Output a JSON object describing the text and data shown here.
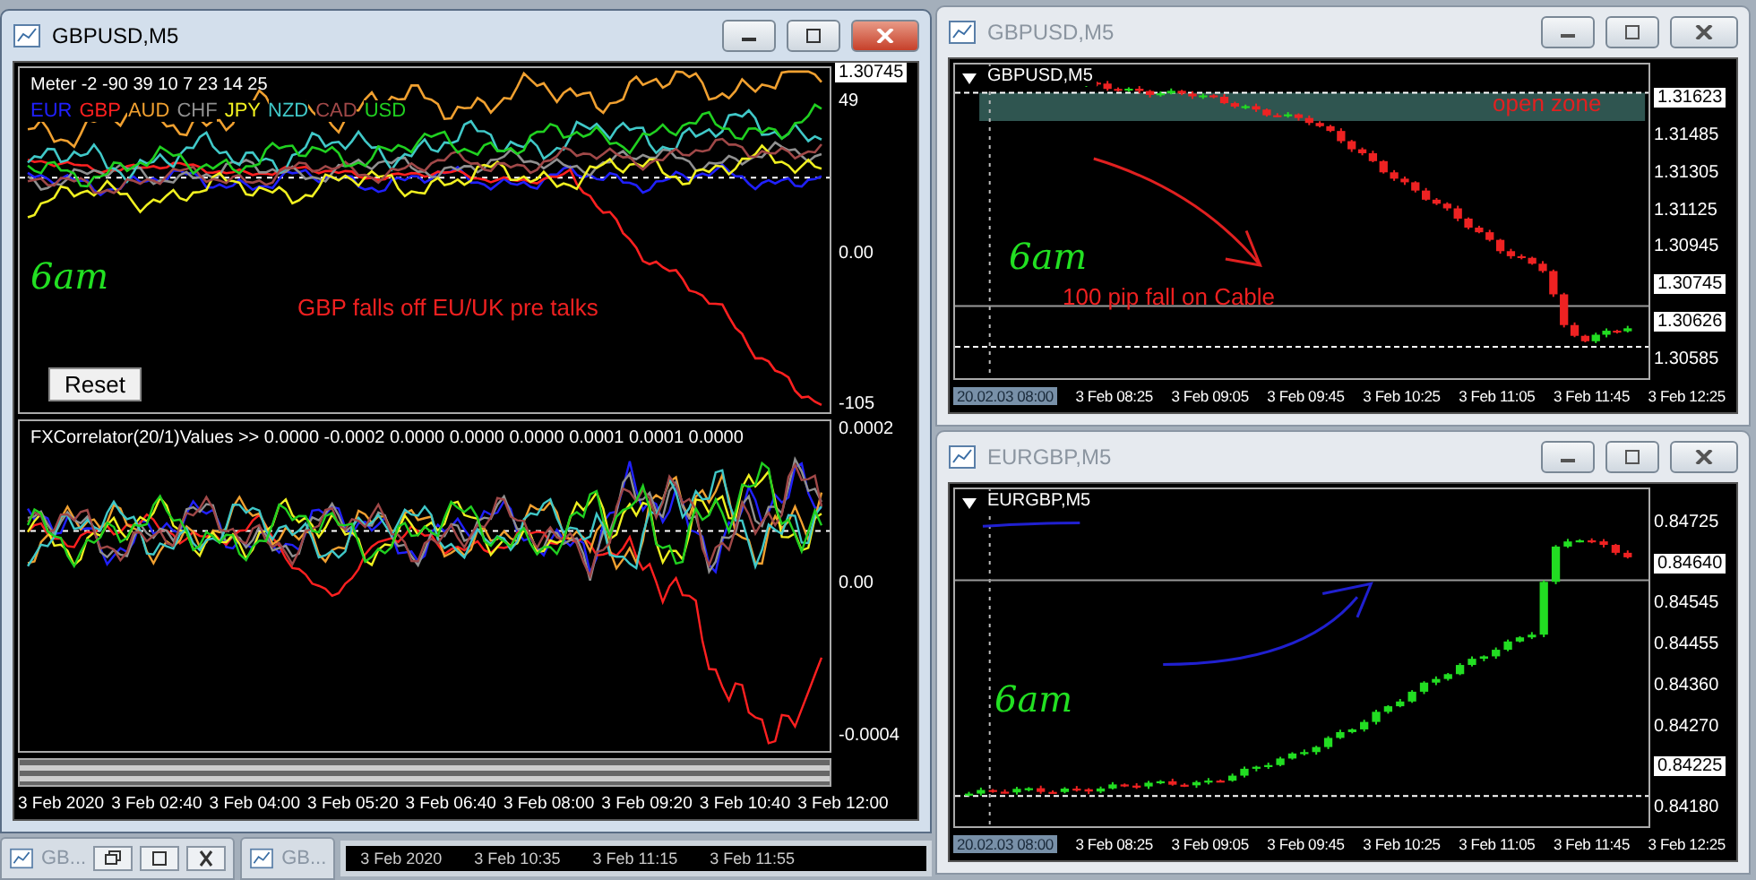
{
  "meter_window": {
    "title": "GBPUSD,M5",
    "active": true,
    "meter_pane": {
      "header": "Meter -2 -90 39 10 7 23 14 25",
      "legend": [
        {
          "label": "EUR",
          "color": "#2020ff"
        },
        {
          "label": "GBP",
          "color": "#ff2020"
        },
        {
          "label": "AUD",
          "color": "#f0a030"
        },
        {
          "label": "CHF",
          "color": "#909090"
        },
        {
          "label": "JPY",
          "color": "#f0f020"
        },
        {
          "label": "NZD",
          "color": "#40c8c8"
        },
        {
          "label": "CAD",
          "color": "#a04848"
        },
        {
          "label": "USD",
          "color": "#20d020"
        }
      ],
      "price_tag": "1.30745",
      "scale": [
        "49",
        "0.00",
        "-105"
      ],
      "note": "GBP falls off EU/UK pre talks",
      "handwriting": "6am",
      "button": "Reset"
    },
    "correlator_pane": {
      "header": "FXCorrelator(20/1)Values >> 0.0000 -0.0002 0.0000 0.0000 0.0000 0.0001 0.0001 0.0000",
      "scale": [
        "0.0002",
        "0.00",
        "-0.0004"
      ]
    },
    "time_axis": [
      "3 Feb 2020",
      "3 Feb 02:40",
      "3 Feb 04:00",
      "3 Feb 05:20",
      "3 Feb 06:40",
      "3 Feb 08:00",
      "3 Feb 09:20",
      "3 Feb 10:40",
      "3 Feb 12:00"
    ]
  },
  "minimized": [
    {
      "label": "GB..."
    },
    {
      "label": "GB..."
    }
  ],
  "background_window": {
    "time_axis": [
      "3 Feb 2020",
      "3 Feb 10:35",
      "3 Feb 11:15",
      "3 Feb 11:55"
    ]
  },
  "price_windows": [
    {
      "kind": "falling",
      "title": "GBPUSD,M5",
      "active": false,
      "symbol": "GBPUSD,M5",
      "zone": "open zone",
      "note": "100 pip fall on Cable",
      "handwriting": "6am",
      "scale": [
        {
          "text": "1.31623",
          "highlighted": true
        },
        {
          "text": "1.31485",
          "highlighted": false
        },
        {
          "text": "1.31305",
          "highlighted": false
        },
        {
          "text": "1.31125",
          "highlighted": false
        },
        {
          "text": "1.30945",
          "highlighted": false
        },
        {
          "text": "1.30745",
          "highlighted": true
        },
        {
          "text": "1.30626",
          "highlighted": true
        },
        {
          "text": "1.30585",
          "highlighted": false
        }
      ],
      "time_axis": [
        {
          "text": "20.02.03 08:00",
          "highlighted": true
        },
        {
          "text": "3 Feb 08:25",
          "highlighted": false
        },
        {
          "text": "3 Feb 09:05",
          "highlighted": false
        },
        {
          "text": "3 Feb 09:45",
          "highlighted": false
        },
        {
          "text": "3 Feb 10:25",
          "highlighted": false
        },
        {
          "text": "3 Feb 11:05",
          "highlighted": false
        },
        {
          "text": "3 Feb 11:45",
          "highlighted": false
        },
        {
          "text": "3 Feb 12:25",
          "highlighted": false
        }
      ]
    },
    {
      "kind": "rising",
      "title": "EURGBP,M5",
      "active": false,
      "symbol": "EURGBP,M5",
      "handwriting": "6am",
      "scale": [
        {
          "text": "0.84725",
          "highlighted": false
        },
        {
          "text": "0.84640",
          "highlighted": true
        },
        {
          "text": "0.84545",
          "highlighted": false
        },
        {
          "text": "0.84455",
          "highlighted": false
        },
        {
          "text": "0.84360",
          "highlighted": false
        },
        {
          "text": "0.84270",
          "highlighted": false
        },
        {
          "text": "0.84225",
          "highlighted": true
        },
        {
          "text": "0.84180",
          "highlighted": false
        }
      ],
      "time_axis": [
        {
          "text": "20.02.03 08:00",
          "highlighted": true
        },
        {
          "text": "3 Feb 08:25",
          "highlighted": false
        },
        {
          "text": "3 Feb 09:05",
          "highlighted": false
        },
        {
          "text": "3 Feb 09:45",
          "highlighted": false
        },
        {
          "text": "3 Feb 10:25",
          "highlighted": false
        },
        {
          "text": "3 Feb 11:05",
          "highlighted": false
        },
        {
          "text": "3 Feb 11:45",
          "highlighted": false
        },
        {
          "text": "3 Feb 12:25",
          "highlighted": false
        }
      ]
    }
  ]
}
